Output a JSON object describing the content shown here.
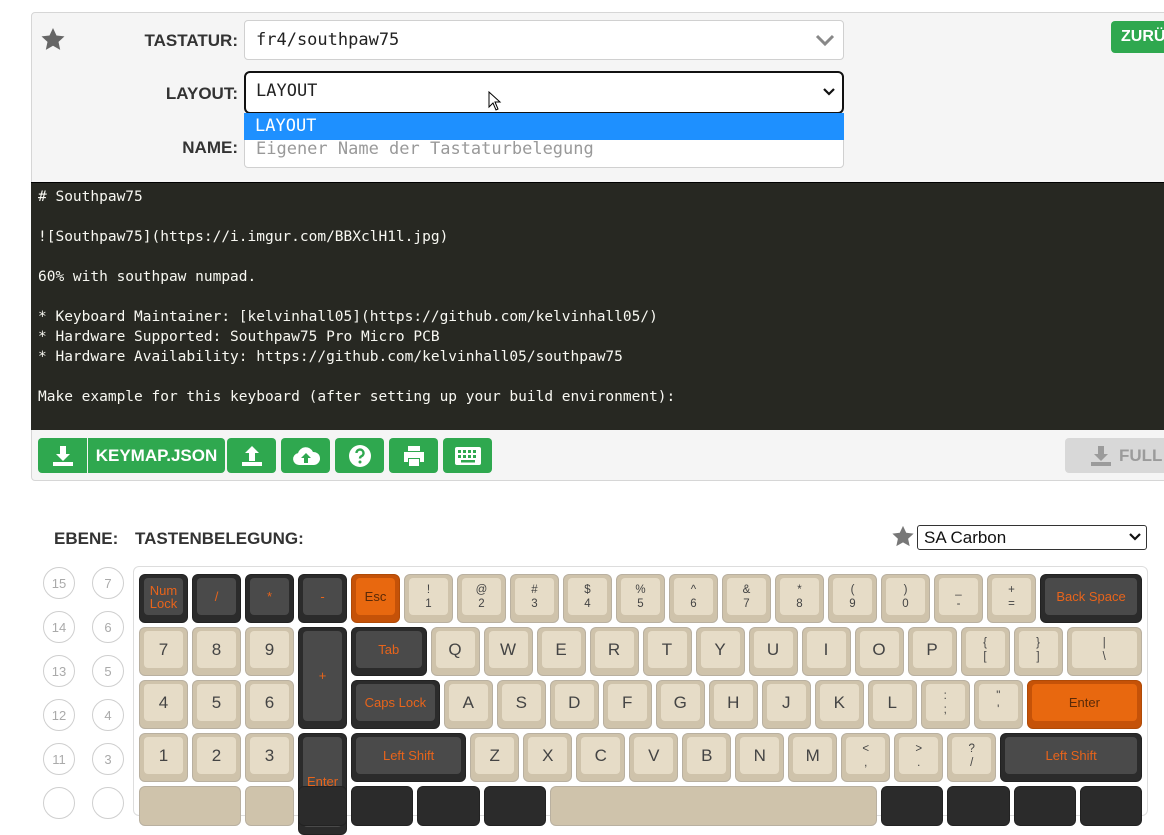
{
  "form": {
    "keyboard_label": "TASTATUR:",
    "keyboard_value": "fr4/southpaw75",
    "layout_label": "LAYOUT:",
    "layout_value": "LAYOUT",
    "layout_options": [
      "LAYOUT"
    ],
    "name_label": "NAME:",
    "name_placeholder": "Eigener Name der Tastaturbelegung",
    "reset_label": "ZURÜ"
  },
  "readme": {
    "lines": [
      "# Southpaw75",
      "",
      "![Southpaw75](https://i.imgur.com/BBXclH1l.jpg)",
      "",
      "60% with southpaw numpad.",
      "",
      "* Keyboard Maintainer: [kelvinhall05](https://github.com/kelvinhall05/)",
      "* Hardware Supported: Southpaw75 Pro Micro PCB",
      "* Hardware Availability: https://github.com/kelvinhall05/southpaw75",
      "",
      "Make example for this keyboard (after setting up your build environment):",
      ""
    ]
  },
  "toolbar": {
    "keymap_json_label": "KEYMAP.JSON",
    "full_label": "FULL",
    "icons": [
      "download-icon",
      "upload-icon",
      "cloud-upload-icon",
      "help-icon",
      "print-icon",
      "keyboard-icon"
    ],
    "accent": "#2fa84f"
  },
  "keymap": {
    "layer_label": "EBENE:",
    "keymap_label": "TASTENBELEGUNG:",
    "colorway_value": "SA Carbon",
    "layers_left": [
      "15",
      "14",
      "13",
      "12",
      "11"
    ],
    "layers_right": [
      "7",
      "6",
      "5",
      "4",
      "3"
    ]
  },
  "keys": {
    "r1": [
      {
        "label": "Num Lock",
        "style": "dark"
      },
      {
        "label": "/",
        "style": "dark"
      },
      {
        "label": "*",
        "style": "dark"
      },
      {
        "label": "-",
        "style": "dark"
      },
      {
        "label": "Esc",
        "style": "orange"
      },
      {
        "top": "!",
        "bottom": "1",
        "style": "beige"
      },
      {
        "top": "@",
        "bottom": "2",
        "style": "beige"
      },
      {
        "top": "#",
        "bottom": "3",
        "style": "beige"
      },
      {
        "top": "$",
        "bottom": "4",
        "style": "beige"
      },
      {
        "top": "%",
        "bottom": "5",
        "style": "beige"
      },
      {
        "top": "^",
        "bottom": "6",
        "style": "beige"
      },
      {
        "top": "&",
        "bottom": "7",
        "style": "beige"
      },
      {
        "top": "*",
        "bottom": "8",
        "style": "beige"
      },
      {
        "top": "(",
        "bottom": "9",
        "style": "beige"
      },
      {
        "top": ")",
        "bottom": "0",
        "style": "beige"
      },
      {
        "top": "_",
        "bottom": "-",
        "style": "beige"
      },
      {
        "top": "+",
        "bottom": "=",
        "style": "beige"
      },
      {
        "label": "Back Space",
        "style": "dark"
      }
    ],
    "r2": [
      {
        "label": "7",
        "style": "beige"
      },
      {
        "label": "8",
        "style": "beige"
      },
      {
        "label": "9",
        "style": "beige"
      },
      {
        "label": "+",
        "style": "dark"
      },
      {
        "label": "Tab",
        "style": "dark"
      },
      {
        "label": "Q",
        "style": "beige"
      },
      {
        "label": "W",
        "style": "beige"
      },
      {
        "label": "E",
        "style": "beige"
      },
      {
        "label": "R",
        "style": "beige"
      },
      {
        "label": "T",
        "style": "beige"
      },
      {
        "label": "Y",
        "style": "beige"
      },
      {
        "label": "U",
        "style": "beige"
      },
      {
        "label": "I",
        "style": "beige"
      },
      {
        "label": "O",
        "style": "beige"
      },
      {
        "label": "P",
        "style": "beige"
      },
      {
        "top": "{",
        "bottom": "[",
        "style": "beige"
      },
      {
        "top": "}",
        "bottom": "]",
        "style": "beige"
      },
      {
        "top": "|",
        "bottom": "\\",
        "style": "beige"
      }
    ],
    "r3": [
      {
        "label": "4",
        "style": "beige"
      },
      {
        "label": "5",
        "style": "beige"
      },
      {
        "label": "6",
        "style": "beige"
      },
      {
        "label": "Caps Lock",
        "style": "dark"
      },
      {
        "label": "A",
        "style": "beige"
      },
      {
        "label": "S",
        "style": "beige"
      },
      {
        "label": "D",
        "style": "beige"
      },
      {
        "label": "F",
        "style": "beige"
      },
      {
        "label": "G",
        "style": "beige"
      },
      {
        "label": "H",
        "style": "beige"
      },
      {
        "label": "J",
        "style": "beige"
      },
      {
        "label": "K",
        "style": "beige"
      },
      {
        "label": "L",
        "style": "beige"
      },
      {
        "top": ":",
        "bottom": ";",
        "style": "beige"
      },
      {
        "top": "\"",
        "bottom": "'",
        "style": "beige"
      },
      {
        "label": "Enter",
        "style": "orange"
      }
    ],
    "r4": [
      {
        "label": "1",
        "style": "beige"
      },
      {
        "label": "2",
        "style": "beige"
      },
      {
        "label": "3",
        "style": "beige"
      },
      {
        "label": "Enter",
        "style": "dark"
      },
      {
        "label": "Left Shift",
        "style": "dark"
      },
      {
        "label": "Z",
        "style": "beige"
      },
      {
        "label": "X",
        "style": "beige"
      },
      {
        "label": "C",
        "style": "beige"
      },
      {
        "label": "V",
        "style": "beige"
      },
      {
        "label": "B",
        "style": "beige"
      },
      {
        "label": "N",
        "style": "beige"
      },
      {
        "label": "M",
        "style": "beige"
      },
      {
        "top": "<",
        "bottom": ",",
        "style": "beige"
      },
      {
        "top": ">",
        "bottom": ".",
        "style": "beige"
      },
      {
        "top": "?",
        "bottom": "/",
        "style": "beige"
      },
      {
        "label": "Left Shift",
        "style": "dark"
      }
    ]
  }
}
